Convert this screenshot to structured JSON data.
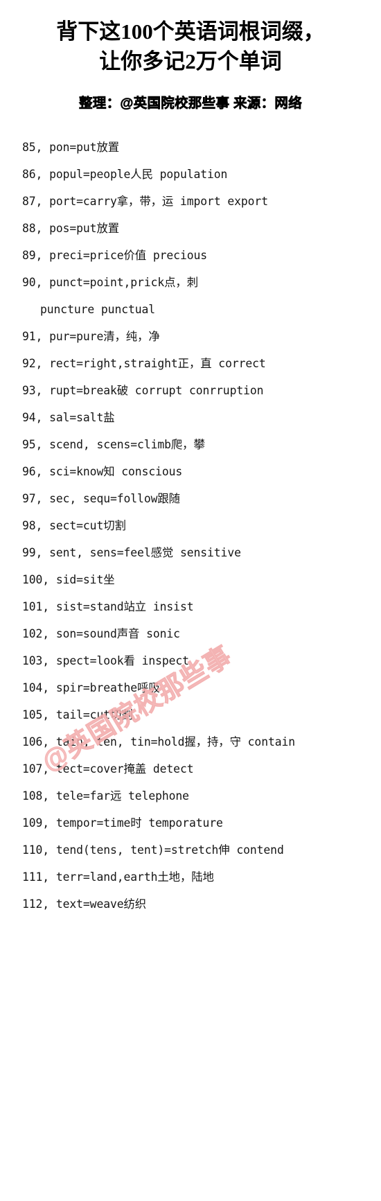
{
  "header": {
    "title_line_1": "背下这100个英语词根词缀，",
    "title_line_2": "让你多记2万个单词",
    "subtitle": "整理：@英国院校那些事 来源：网络"
  },
  "watermark": {
    "text": "@英国院校那些事",
    "color": "#f6b8b8"
  },
  "colors": {
    "background": "#ffffff",
    "text": "#161616",
    "title": "#000000",
    "watermark": "#f6b8b8"
  },
  "entries": [
    {
      "text": "85, pon=put放置",
      "continuation": false
    },
    {
      "text": "86, popul=people人民   population",
      "continuation": false
    },
    {
      "text": "87, port=carry拿，带，运  import export",
      "continuation": false
    },
    {
      "text": "88, pos=put放置",
      "continuation": false
    },
    {
      "text": "89, preci=price价值   precious",
      "continuation": false
    },
    {
      "text": "90, punct=point,prick点，刺",
      "continuation": false
    },
    {
      "text": "puncture punctual",
      "continuation": true
    },
    {
      "text": "91, pur=pure清，纯，净",
      "continuation": false
    },
    {
      "text": "92, rect=right,straight正，直   correct",
      "continuation": false
    },
    {
      "text": "93, rupt=break破     corrupt conrruption",
      "continuation": false
    },
    {
      "text": "94, sal=salt盐",
      "continuation": false
    },
    {
      "text": "95, scend, scens=climb爬，攀",
      "continuation": false
    },
    {
      "text": "96, sci=know知   conscious",
      "continuation": false
    },
    {
      "text": "97, sec, sequ=follow跟随",
      "continuation": false
    },
    {
      "text": "98, sect=cut切割",
      "continuation": false
    },
    {
      "text": "99, sent, sens=feel感觉   sensitive",
      "continuation": false
    },
    {
      "text": "100, sid=sit坐",
      "continuation": false
    },
    {
      "text": "101, sist=stand站立   insist",
      "continuation": false
    },
    {
      "text": "102, son=sound声音    sonic",
      "continuation": false
    },
    {
      "text": "103, spect=look看   inspect",
      "continuation": false
    },
    {
      "text": "104, spir=breathe呼吸",
      "continuation": false
    },
    {
      "text": "105, tail=cut切割",
      "continuation": false
    },
    {
      "text": "106, tain, ten, tin=hold握，持，守   contain",
      "continuation": false
    },
    {
      "text": "107, tect=cover掩盖   detect",
      "continuation": false
    },
    {
      "text": "108, tele=far远   telephone",
      "continuation": false
    },
    {
      "text": "109, tempor=time时   temporature",
      "continuation": false
    },
    {
      "text": "110, tend(tens, tent)=stretch伸   contend",
      "continuation": false
    },
    {
      "text": "111, terr=land,earth土地，陆地",
      "continuation": false
    },
    {
      "text": "112, text=weave纺织",
      "continuation": false
    }
  ]
}
